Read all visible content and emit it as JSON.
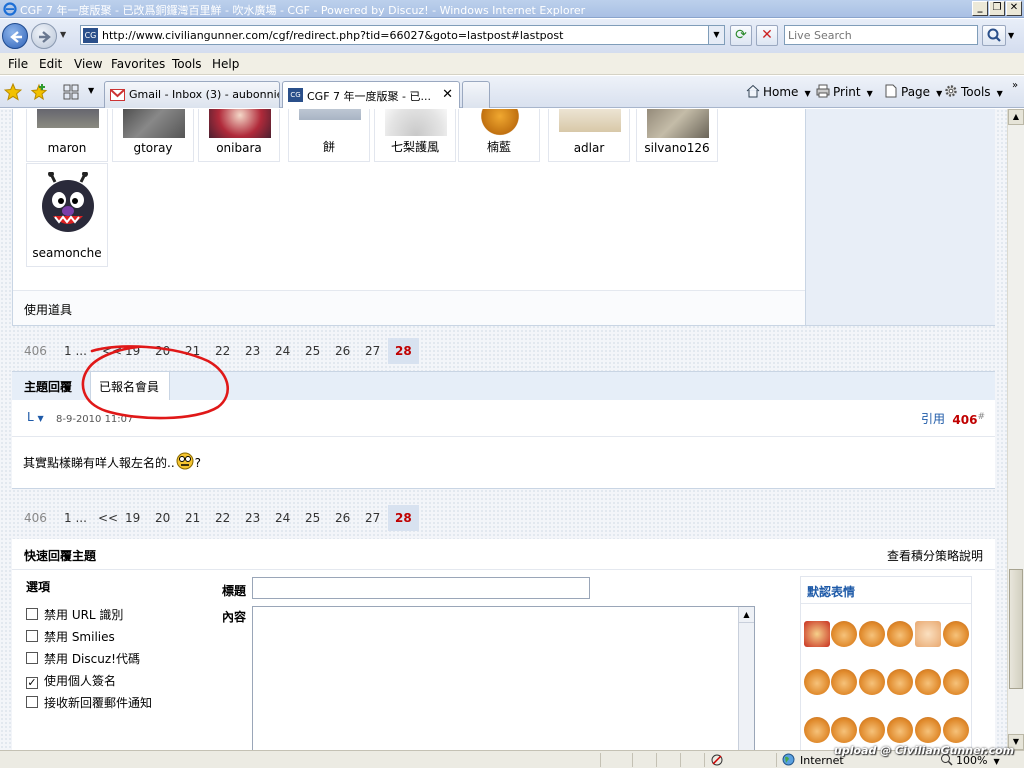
{
  "window": {
    "title": "CGF 7 年一度版聚 - 已改爲銅鑼灣百里鮮 - 吹水廣場 - CGF - Powered by Discuz! - Windows Internet Explorer",
    "minimize": "_",
    "restore": "❐",
    "close": "✕"
  },
  "addressbar": {
    "url": "http://www.civiliangunner.com/cgf/redirect.php?tid=66027&goto=lastpost#lastpost",
    "search_placeholder": "Live Search"
  },
  "menu": [
    "File",
    "Edit",
    "View",
    "Favorites",
    "Tools",
    "Help"
  ],
  "tabs": [
    {
      "label": "Gmail - Inbox (3) - aubonnie..."
    },
    {
      "label": "CGF 7 年一度版聚 - 已..."
    }
  ],
  "toolbar": {
    "home": "Home",
    "print": "Print",
    "page": "Page",
    "tools": "Tools"
  },
  "members_row": [
    {
      "name": "maron"
    },
    {
      "name": "gtoray"
    },
    {
      "name": "onibara"
    },
    {
      "name": "餅"
    },
    {
      "name": "七梨護風"
    },
    {
      "name": "楠藍"
    },
    {
      "name": "adlar"
    },
    {
      "name": "silvano126"
    }
  ],
  "member_last": {
    "name": "seamonche"
  },
  "use_tools": "使用道具",
  "pager": {
    "total": "406",
    "first": "1 ...",
    "prev": "<<",
    "pages": [
      "19",
      "20",
      "21",
      "22",
      "23",
      "24",
      "25",
      "26",
      "27"
    ],
    "current": "28"
  },
  "thread_tabs": {
    "replies": "主題回覆",
    "registered": "已報名會員"
  },
  "post": {
    "author": "L",
    "date": "8-9-2010 11:07",
    "quote": "引用",
    "floor": "406",
    "floor_suffix": "#",
    "body": "其實點樣睇有咩人報左名的..",
    "body_end": "?"
  },
  "quick_reply": {
    "title": "快速回覆主題",
    "credits_link": "查看積分策略說明",
    "options_title": "選項",
    "options": [
      {
        "label": "禁用 URL 識別",
        "checked": false
      },
      {
        "label": "禁用 Smilies",
        "checked": false
      },
      {
        "label": "禁用 Discuz!代碼",
        "checked": false
      },
      {
        "label": "使用個人簽名",
        "checked": true
      },
      {
        "label": "接收新回覆郵件通知",
        "checked": false
      }
    ],
    "subject_label": "標題",
    "content_label": "內容",
    "smilies_title": "默認表情"
  },
  "status": {
    "zone": "Internet",
    "zoom": "100%"
  },
  "watermark": "upload @ CivilianGunner.com",
  "colors": {
    "accent": "#1e5aa8",
    "current_page": "#c00000",
    "annotation": "#e01818"
  }
}
